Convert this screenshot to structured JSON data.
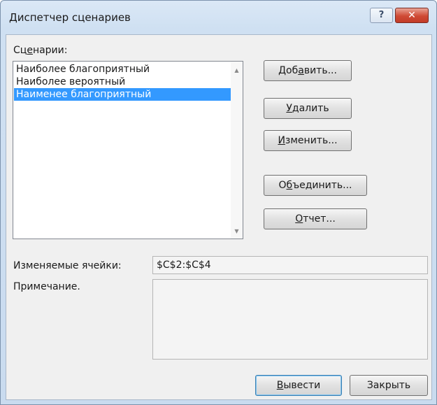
{
  "window": {
    "title": "Диспетчер сценариев",
    "help_glyph": "?",
    "close_glyph": "✕"
  },
  "scenarios": {
    "label": "Сценарии:",
    "items": [
      {
        "label": "Наиболее благоприятный",
        "selected": false
      },
      {
        "label": "Наиболее вероятный",
        "selected": false
      },
      {
        "label": "Наименее благоприятный",
        "selected": true
      }
    ]
  },
  "buttons": {
    "add": "Добавить...",
    "delete": "Удалить",
    "edit": "Изменить...",
    "merge": "Объединить...",
    "report": "Отчет...",
    "show": "Вывести",
    "close": "Закрыть"
  },
  "changing_cells": {
    "label": "Изменяемые ячейки:",
    "value": "$C$2:$C$4"
  },
  "comment": {
    "label": "Примечание.",
    "value": ""
  }
}
